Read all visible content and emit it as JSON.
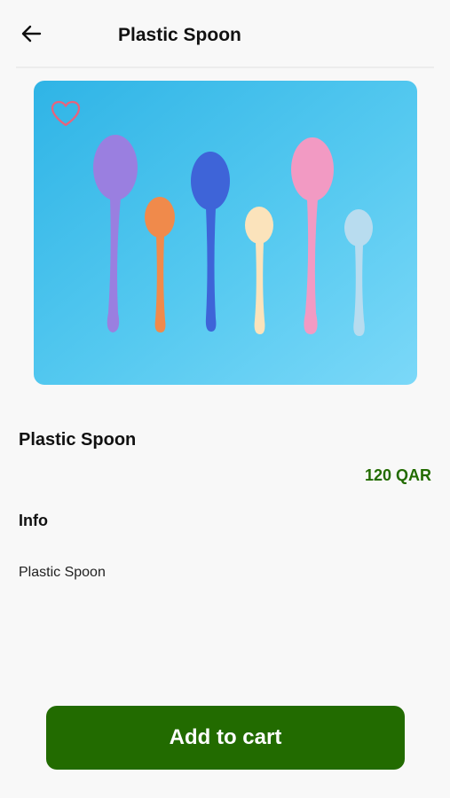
{
  "header": {
    "title": "Plastic Spoon",
    "back_icon": "arrow-left-icon"
  },
  "product": {
    "image_subject": "six colorful plastic spoons on a blue background",
    "favorite_icon": "heart-outline-icon",
    "name": "Plastic Spoon",
    "price": "120 QAR"
  },
  "info": {
    "heading": "Info",
    "description": "Plastic Spoon"
  },
  "cart": {
    "button_label": "Add to cart"
  },
  "colors": {
    "primary": "#226b00",
    "background": "#f8f8f8",
    "image_bg": "#4cc3ec",
    "heart": "#e8637c"
  }
}
